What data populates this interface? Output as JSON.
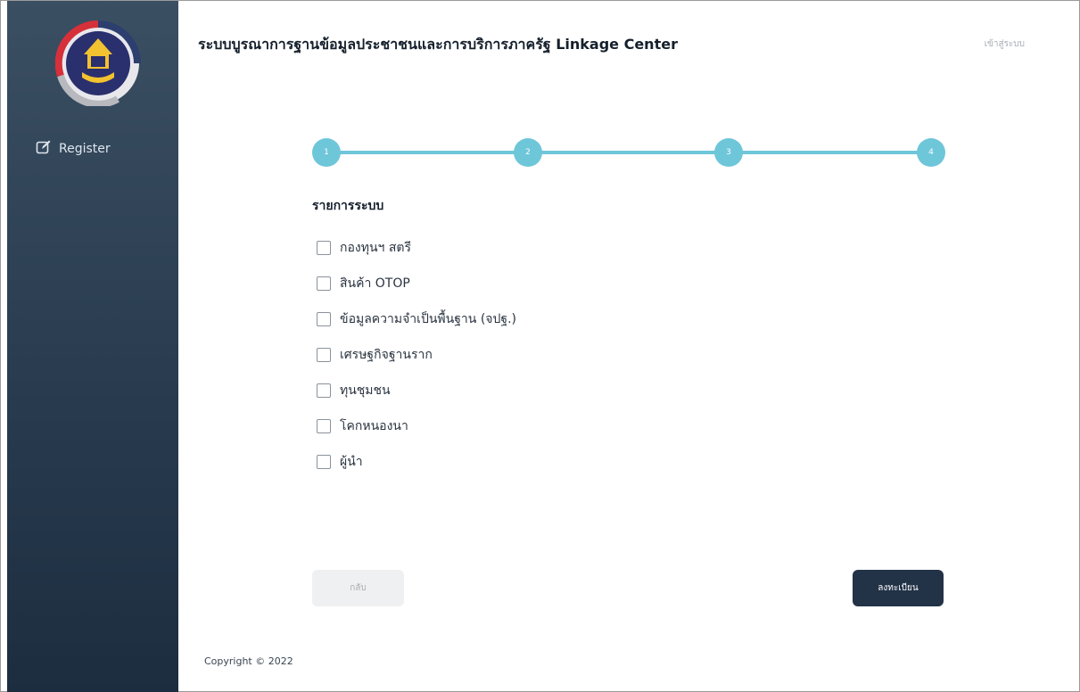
{
  "app": {
    "title": "ระบบบูรณาการฐานข้อมูลประชาชนและการบริการภาครัฐ Linkage Center",
    "login_label": "เข้าสู่ระบบ"
  },
  "sidebar": {
    "logo_icon": "department-emblem-logo",
    "items": [
      {
        "label": "Register",
        "icon": "edit-icon"
      }
    ]
  },
  "stepper": {
    "current_step": 4,
    "steps": [
      "1",
      "2",
      "3",
      "4"
    ],
    "color": "#6ec6d9"
  },
  "form": {
    "section_title": "รายการระบบ",
    "options": [
      {
        "label": "กองทุนฯ สตรี",
        "checked": false
      },
      {
        "label": "สินค้า OTOP",
        "checked": false
      },
      {
        "label": "ข้อมูลความจำเป็นพื้นฐาน (จปฐ.)",
        "checked": false
      },
      {
        "label": "เศรษฐกิจฐานราก",
        "checked": false
      },
      {
        "label": "ทุนชุมชน",
        "checked": false
      },
      {
        "label": "โคกหนองนา",
        "checked": false
      },
      {
        "label": "ผู้นำ",
        "checked": false
      }
    ],
    "back_label": "กลับ",
    "submit_label": "ลงทะเบียน"
  },
  "footer": {
    "copyright": "Copyright © 2022"
  },
  "colors": {
    "sidebar_top": "#3b4f63",
    "sidebar_bottom": "#1c2d3f",
    "primary_button": "#223247",
    "accent": "#6ec6d9"
  }
}
